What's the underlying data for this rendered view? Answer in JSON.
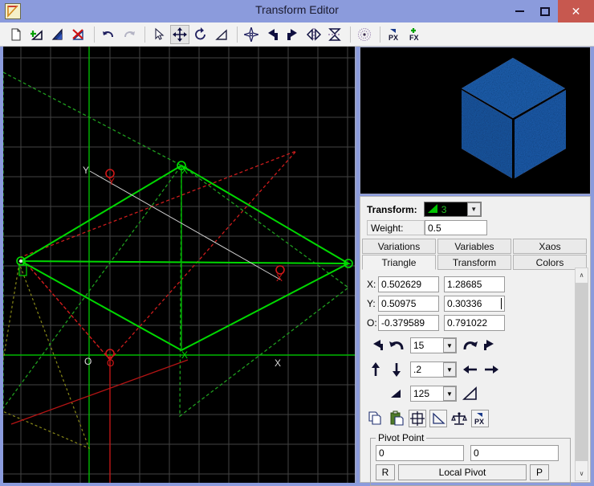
{
  "window": {
    "title": "Transform Editor",
    "app_icon": "flame-triangle-icon",
    "minimize_label": "–",
    "maximize_label": "□",
    "close_label": "✕"
  },
  "toolbar": {
    "items": [
      {
        "name": "new-transform-icon",
        "glyph": "document"
      },
      {
        "name": "add-transform-icon",
        "glyph": "add-triangle"
      },
      {
        "name": "duplicate-transform-icon",
        "glyph": "blue-triangle"
      },
      {
        "name": "delete-transform-icon",
        "glyph": "delete-triangle"
      },
      {
        "name": "undo-icon",
        "glyph": "undo"
      },
      {
        "name": "redo-icon",
        "glyph": "redo"
      },
      {
        "name": "select-tool-icon",
        "glyph": "cursor"
      },
      {
        "name": "move-tool-icon",
        "glyph": "move"
      },
      {
        "name": "rotate-tool-icon",
        "glyph": "rotate"
      },
      {
        "name": "scale-tool-icon",
        "glyph": "scale-triangle"
      },
      {
        "name": "center-origin-icon",
        "glyph": "four-point-star"
      },
      {
        "name": "rotate-left-icon",
        "glyph": "arrow-turn-left"
      },
      {
        "name": "rotate-right-icon",
        "glyph": "arrow-turn-right"
      },
      {
        "name": "flip-horizontal-icon",
        "glyph": "flip-h"
      },
      {
        "name": "flip-vertical-icon",
        "glyph": "flip-v"
      },
      {
        "name": "show-guides-icon",
        "glyph": "dotted-eye"
      },
      {
        "name": "post-transform-icon",
        "glyph": "px"
      },
      {
        "name": "final-transform-icon",
        "glyph": "fx-add"
      }
    ]
  },
  "panel": {
    "transform_label": "Transform:",
    "transform_value": "3",
    "transform_icon": "green-triangle-icon",
    "weight_label": "Weight:",
    "weight_value": "0.5",
    "tabs_row1": [
      {
        "label": "Variations",
        "active": false
      },
      {
        "label": "Variables",
        "active": false
      },
      {
        "label": "Xaos",
        "active": false
      }
    ],
    "tabs_row2": [
      {
        "label": "Triangle",
        "active": true
      },
      {
        "label": "Transform",
        "active": false
      },
      {
        "label": "Colors",
        "active": false
      }
    ],
    "coords": [
      {
        "label": "X:",
        "v1": "0.502629",
        "v2": "1.28685"
      },
      {
        "label": "Y:",
        "v1": "0.50975",
        "v2": "0.30336"
      },
      {
        "label": "O:",
        "v1": "-0.379589",
        "v2": "0.791022"
      }
    ],
    "rotate_row": {
      "rotate_left_fine": "↖",
      "rotate_left": "↶",
      "step": "15",
      "rotate_right": "↷",
      "rotate_right_fine": "↗"
    },
    "move_row": {
      "move_up": "↑",
      "move_down": "↓",
      "step": ".2",
      "move_left": "←",
      "move_right": "→"
    },
    "scale_row": {
      "scale_down_icon": "shrink-triangle-icon",
      "step": "125",
      "scale_up_icon": "grow-triangle-icon"
    },
    "action_icons": [
      {
        "name": "copy-triangle-icon",
        "glyph": "copy"
      },
      {
        "name": "paste-triangle-icon",
        "glyph": "paste"
      },
      {
        "name": "reset-triangle-icon",
        "glyph": "reset-bounds"
      },
      {
        "name": "reset-shape-icon",
        "glyph": "right-triangle"
      },
      {
        "name": "balance-icon",
        "glyph": "scales"
      },
      {
        "name": "post-triangle-icon",
        "glyph": "px"
      }
    ],
    "pivot": {
      "legend": "Pivot Point",
      "x": "0",
      "y": "0",
      "reset_label": "R",
      "mode_label": "Local Pivot",
      "pick_label": "P"
    },
    "scroll_up": "∧",
    "scroll_down": "∨"
  },
  "colors": {
    "titlebar": "#8b9bdc",
    "close_button": "#c7584f",
    "panel_bg": "#f0f0f0",
    "canvas_bg": "#000000",
    "grid": "#4a4a4a",
    "active_triangle": "#00d800",
    "other_triangle": "#cc1c1c",
    "dim_triangle": "#8a8a18",
    "cube_blue": "#1e62b4",
    "combo_text": "#25c325"
  },
  "preview": {
    "name": "flame-render-preview",
    "description": "isometric blue cube"
  },
  "canvas": {
    "name": "triangle-editor-canvas",
    "grid_spacing": 37,
    "origin_labels": [
      "O",
      "O",
      "X",
      "X",
      "Y",
      "Y"
    ]
  }
}
